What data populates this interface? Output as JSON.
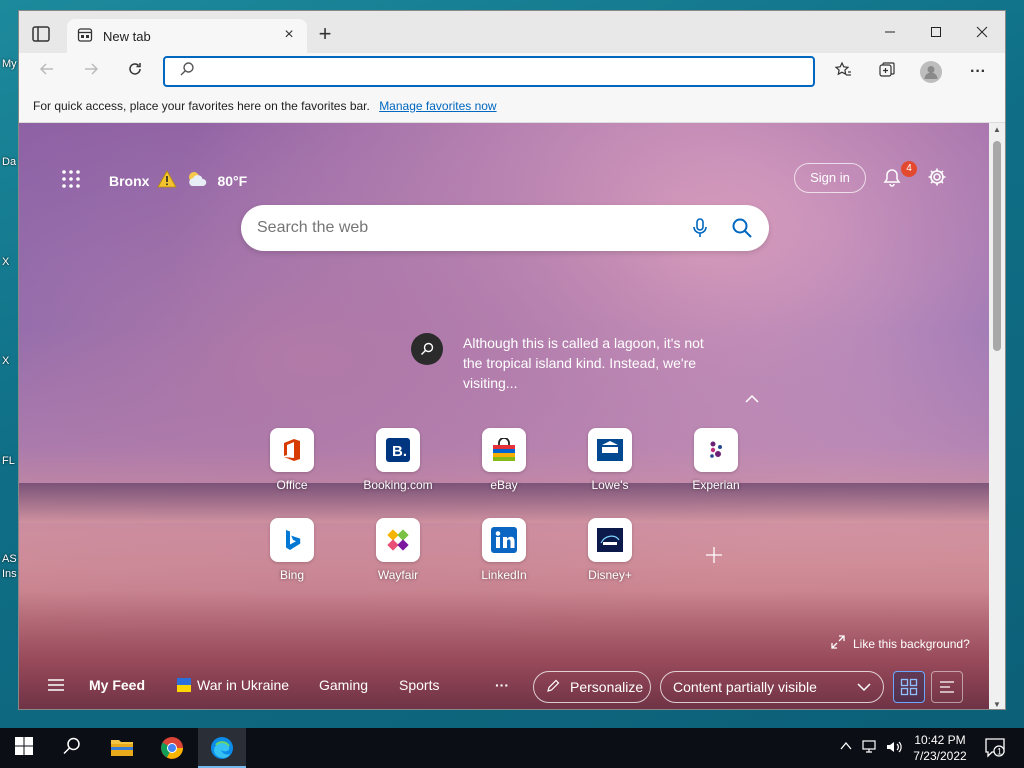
{
  "desktop": {
    "labels": [
      "My",
      "Da",
      "X",
      "X",
      "FL",
      "AS",
      "Ins"
    ]
  },
  "browser": {
    "tab_title": "New tab",
    "tab_close": "×",
    "new_tab": "+",
    "address_value": "",
    "favorites_bar": {
      "text": "For quick access, place your favorites here on the favorites bar.",
      "link": "Manage favorites now"
    }
  },
  "ntp": {
    "location": "Bronx",
    "temperature": "80°F",
    "sign_in": "Sign in",
    "notification_count": "4",
    "search_placeholder": "Search the web",
    "caption": "Although this is called a lagoon, it's not the tropical island kind. Instead, we're visiting...",
    "tiles": [
      {
        "label": "Office",
        "icon": "office-icon",
        "color": "#d83b01"
      },
      {
        "label": "Booking.com",
        "icon": "booking-icon",
        "color": "#003580"
      },
      {
        "label": "eBay",
        "icon": "ebay-icon",
        "color": "#e53238"
      },
      {
        "label": "Lowe's",
        "icon": "lowes-icon",
        "color": "#004990"
      },
      {
        "label": "Experian",
        "icon": "experian-icon",
        "color": "#6d2077"
      },
      {
        "label": "Bing",
        "icon": "bing-icon",
        "color": "#0078d4"
      },
      {
        "label": "Wayfair",
        "icon": "wayfair-icon",
        "color": "#7b189f"
      },
      {
        "label": "LinkedIn",
        "icon": "linkedin-icon",
        "color": "#0a66c2"
      },
      {
        "label": "Disney+",
        "icon": "disney-icon",
        "color": "#0b1a4a"
      }
    ],
    "like_background": "Like this background?",
    "feed": {
      "my_feed": "My Feed",
      "items": [
        "War in Ukraine",
        "Gaming",
        "Sports"
      ],
      "more": "···",
      "personalize": "Personalize",
      "content_visibility": "Content partially visible"
    }
  },
  "taskbar": {
    "time": "10:42 PM",
    "date": "7/23/2022",
    "notification_count": "1"
  }
}
